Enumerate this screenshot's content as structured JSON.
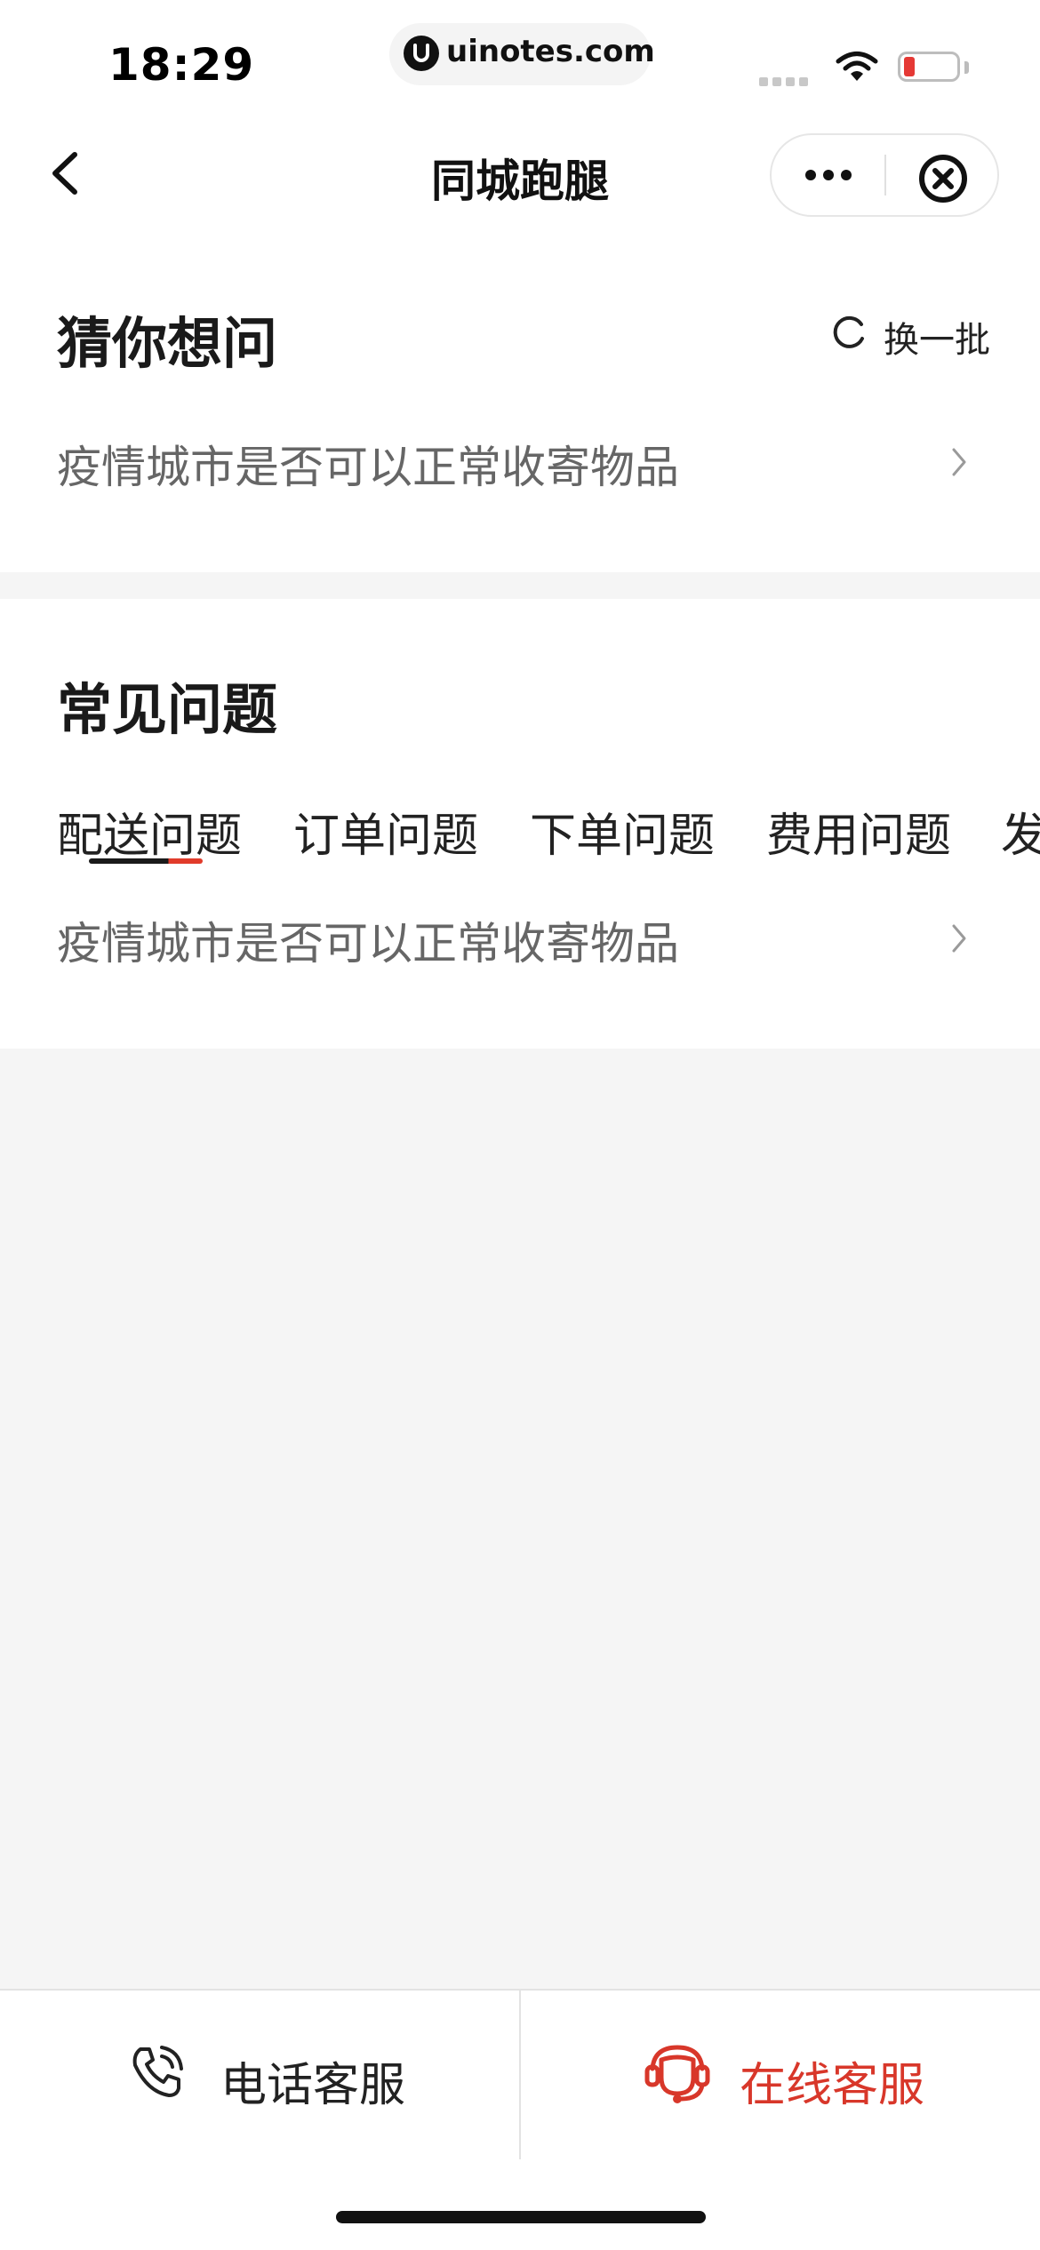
{
  "status_bar": {
    "time": "18:29",
    "url": "uinotes.com"
  },
  "nav": {
    "title": "同城跑腿"
  },
  "guess": {
    "title": "猜你想问",
    "refresh_label": "换一批",
    "items": [
      "疫情城市是否可以正常收寄物品"
    ]
  },
  "faq": {
    "title": "常见问题",
    "tabs": [
      "配送问题",
      "订单问题",
      "下单问题",
      "费用问题",
      "发"
    ],
    "active_tab": 0,
    "items": [
      "疫情城市是否可以正常收寄物品"
    ]
  },
  "bottom_bar": {
    "phone_label": "电话客服",
    "online_label": "在线客服",
    "accent_color": "#d8372a"
  },
  "icons": [
    "chevron-left-icon",
    "more-dots-icon",
    "close-circle-icon",
    "refresh-icon",
    "chevron-right-icon",
    "phone-icon",
    "customer-service-icon"
  ]
}
